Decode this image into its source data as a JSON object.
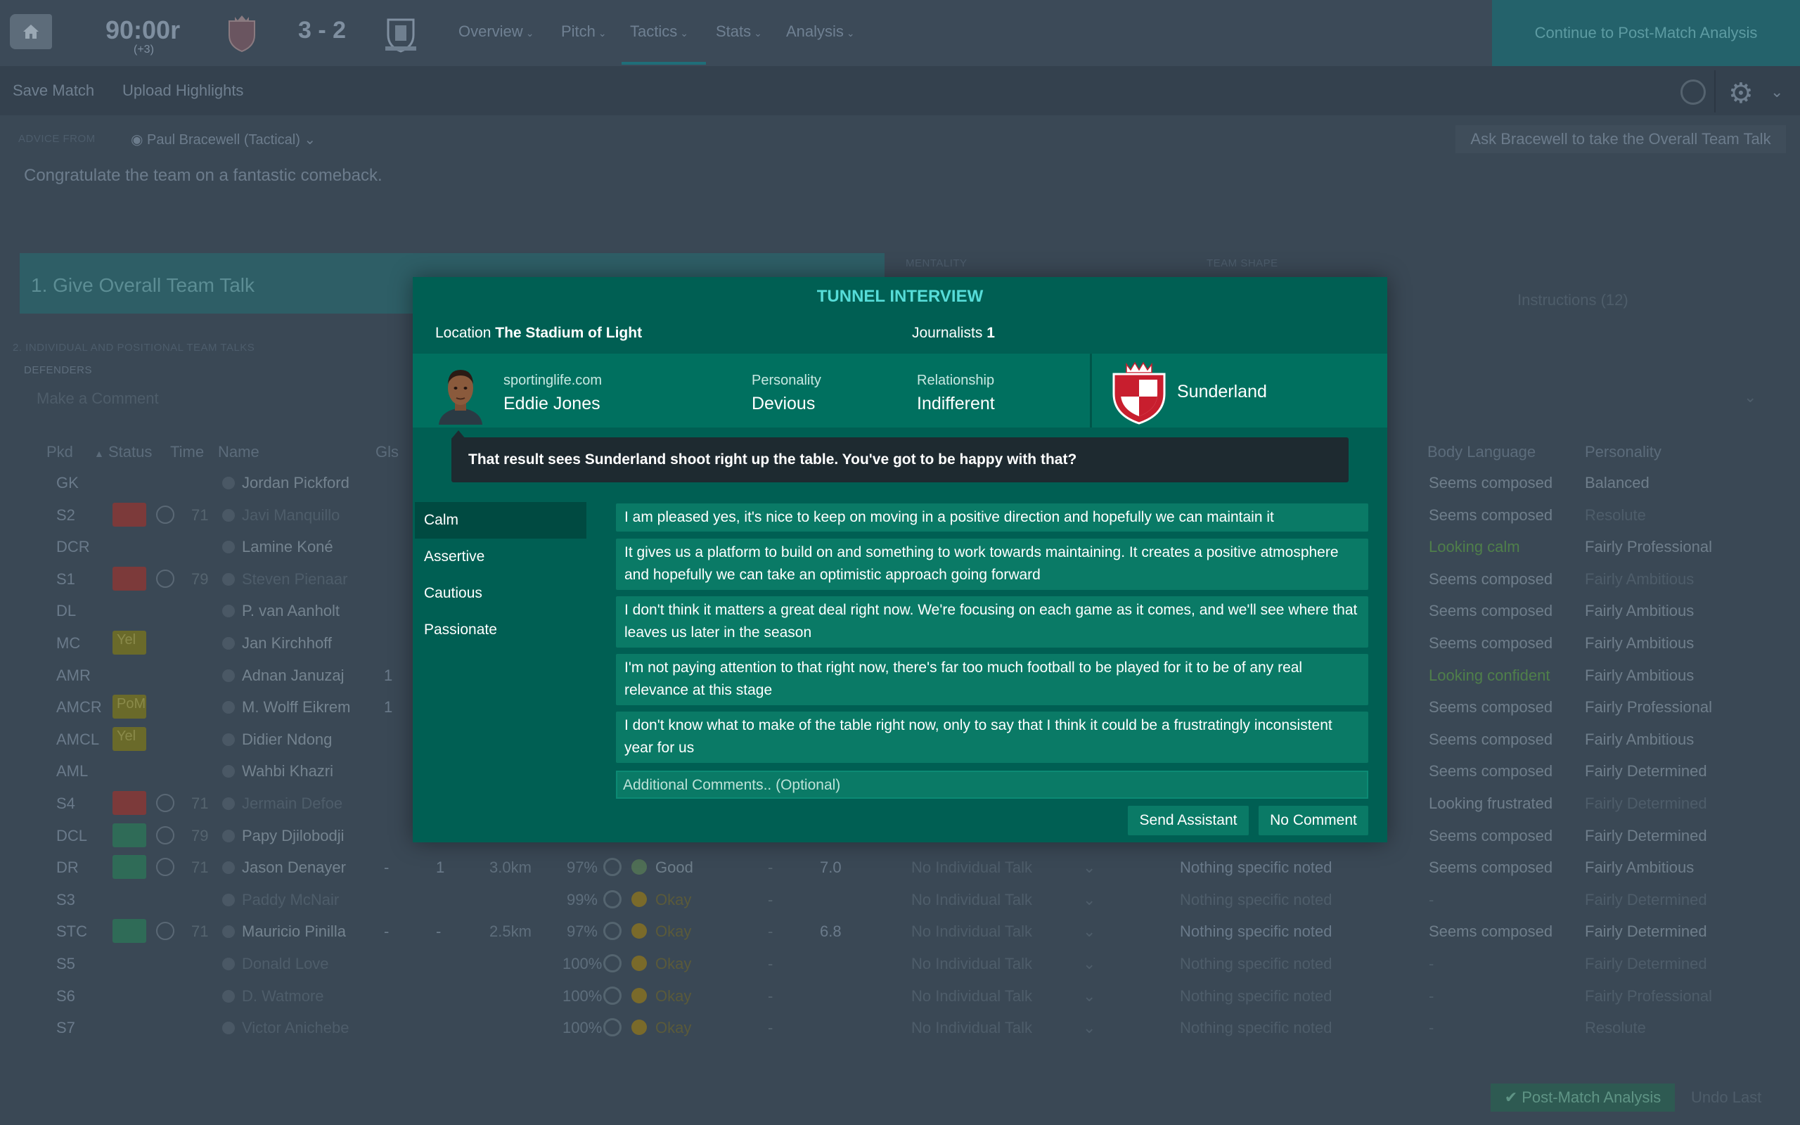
{
  "header": {
    "clock": "90:00r",
    "clock_extra": "(+3)",
    "score": "3 - 2",
    "nav": [
      "Overview",
      "Pitch",
      "Tactics",
      "Stats",
      "Analysis"
    ],
    "continue_label": "Continue to Post-Match Analysis"
  },
  "toolbar": {
    "save_label": "Save Match",
    "upload_label": "Upload Highlights"
  },
  "background": {
    "advice_from_label": "ADVICE FROM",
    "advice_from_value": "Paul Bracewell (Tactical)",
    "ask_button": "Ask Bracewell to take the Overall Team Talk",
    "advice_text": "Congratulate the team on a fantastic comeback.",
    "overall_talk": "1. Give Overall Team Talk",
    "mentality_label": "MENTALITY",
    "team_shape_label": "TEAM SHAPE",
    "instructions": "Instructions (12)",
    "individual_label": "2. INDIVIDUAL AND POSITIONAL TEAM TALKS",
    "defenders_label": "DEFENDERS",
    "comment_placeholder": "Make a Comment",
    "columns": {
      "pkd": "Pkd",
      "status": "Status",
      "time": "Time",
      "name": "Name",
      "gls": "Gls",
      "body": "Body Language",
      "personality": "Personality"
    },
    "rows": [
      {
        "pos": "GK",
        "name": "Jordan Pickford",
        "body": "Seems composed",
        "pers": "Balanced"
      },
      {
        "pos": "S2",
        "time": "71",
        "name": "Javi Manquillo",
        "body": "Seems composed",
        "pers": "Resolute"
      },
      {
        "pos": "DCR",
        "name": "Lamine Koné",
        "body": "Looking calm",
        "pers": "Fairly Professional"
      },
      {
        "pos": "S1",
        "time": "79",
        "name": "Steven Pienaar",
        "body": "Seems composed",
        "pers": "Fairly Ambitious"
      },
      {
        "pos": "DL",
        "name": "P. van Aanholt",
        "body": "Seems composed",
        "pers": "Fairly Ambitious"
      },
      {
        "pos": "MC",
        "status": "Yel",
        "name": "Jan Kirchhoff",
        "body": "Seems composed",
        "pers": "Fairly Ambitious"
      },
      {
        "pos": "AMR",
        "gls": "1",
        "name": "Adnan Januzaj",
        "body": "Looking confident",
        "pers": "Fairly Ambitious"
      },
      {
        "pos": "AMCR",
        "status": "PoM",
        "gls": "1",
        "name": "M. Wolff Eikrem",
        "body": "Seems composed",
        "pers": "Fairly Professional"
      },
      {
        "pos": "AMCL",
        "status": "Yel",
        "name": "Didier Ndong",
        "body": "Seems composed",
        "pers": "Fairly Ambitious"
      },
      {
        "pos": "AML",
        "name": "Wahbi Khazri",
        "body": "Seems composed",
        "pers": "Fairly Determined"
      },
      {
        "pos": "S4",
        "time": "71",
        "name": "Jermain Defoe",
        "body": "Looking frustrated",
        "pers": "Fairly Determined"
      },
      {
        "pos": "DCL",
        "time": "79",
        "name": "Papy Djilobodji",
        "body": "Seems composed",
        "pers": "Fairly Determined"
      },
      {
        "pos": "DR",
        "time": "71",
        "name": "Jason Denayer",
        "gls": "-",
        "ast": "1",
        "dist": "3.0km",
        "pass": "97%",
        "cond": "Good",
        "rating": "7.0",
        "talk": "No Individual Talk",
        "notes": "Nothing specific noted",
        "body": "Seems composed",
        "pers": "Fairly Ambitious"
      },
      {
        "pos": "S3",
        "name": "Paddy McNair",
        "pass": "99%",
        "cond": "Okay",
        "talk": "No Individual Talk",
        "notes": "Nothing specific noted",
        "body": "-",
        "pers": "Fairly Determined"
      },
      {
        "pos": "STC",
        "time": "71",
        "name": "Mauricio Pinilla",
        "gls": "-",
        "ast": "-",
        "dist": "2.5km",
        "pass": "97%",
        "cond": "Okay",
        "rating": "6.8",
        "talk": "No Individual Talk",
        "notes": "Nothing specific noted",
        "body": "Seems composed",
        "pers": "Fairly Determined"
      },
      {
        "pos": "S5",
        "name": "Donald Love",
        "pass": "100%",
        "cond": "Okay",
        "talk": "No Individual Talk",
        "notes": "Nothing specific noted",
        "body": "-",
        "pers": "Fairly Determined"
      },
      {
        "pos": "S6",
        "name": "D. Watmore",
        "pass": "100%",
        "cond": "Okay",
        "talk": "No Individual Talk",
        "notes": "Nothing specific noted",
        "body": "-",
        "pers": "Fairly Professional"
      },
      {
        "pos": "S7",
        "name": "Victor Anichebe",
        "pass": "100%",
        "cond": "Okay",
        "talk": "No Individual Talk",
        "notes": "Nothing specific noted",
        "body": "-",
        "pers": "Resolute"
      }
    ],
    "post_match_btn": "Post-Match Analysis",
    "undo_label": "Undo Last"
  },
  "modal": {
    "title": "TUNNEL INTERVIEW",
    "location_label": "Location",
    "location_value": "The Stadium of Light",
    "journalists_label": "Journalists",
    "journalists_value": "1",
    "outlet": "sportinglife.com",
    "journalist_name": "Eddie Jones",
    "personality_label": "Personality",
    "personality_value": "Devious",
    "relationship_label": "Relationship",
    "relationship_value": "Indifferent",
    "club": "Sunderland",
    "question": "That result sees Sunderland shoot right up the table. You've got to be happy with that?",
    "tones": [
      "Calm",
      "Assertive",
      "Cautious",
      "Passionate"
    ],
    "active_tone": "Calm",
    "answers": [
      "I am pleased yes, it's nice to keep on moving in a positive direction and hopefully we can maintain it",
      "It gives us a platform to build on and something to work towards maintaining. It creates a positive atmosphere and hopefully we can take an optimistic approach going forward",
      "I don't think it matters a great deal right now. We're focusing on each game as it comes, and we'll see where that leaves us later in the season",
      "I'm not paying attention to that right now, there's far too much football to be played for it to be of any real relevance at this stage",
      "I don't know what to make of the table right now, only to say that I think it could be a frustratingly inconsistent year for us"
    ],
    "comments_placeholder": "Additional Comments.. (Optional)",
    "send_assistant": "Send Assistant",
    "no_comment": "No Comment"
  },
  "colors": {
    "modal_bg": "#005f53",
    "accent_title": "#56dcd8",
    "answer_bg": "#0a7a66"
  }
}
